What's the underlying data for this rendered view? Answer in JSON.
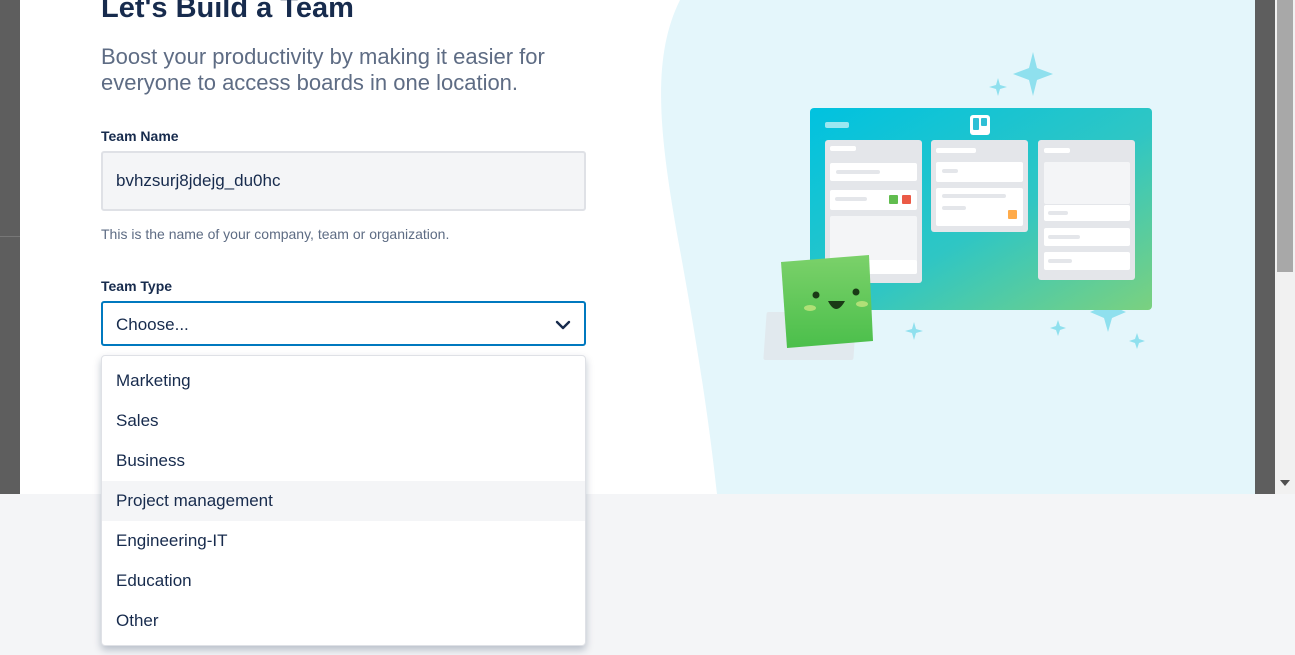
{
  "modal": {
    "title": "Let's Build a Team",
    "subtitle": "Boost your productivity by making it easier for everyone to access boards in one location."
  },
  "form": {
    "team_name_label": "Team Name",
    "team_name_value": "bvhzsurj8jdejg_du0hc",
    "team_name_helper": "This is the name of your company, team or organization.",
    "team_type_label": "Team Type",
    "team_type_selected": "Choose..."
  },
  "dropdown": {
    "options": [
      "Marketing",
      "Sales",
      "Business",
      "Project management",
      "Engineering-IT",
      "Education",
      "Other"
    ],
    "highlighted": "Project management"
  },
  "icons": {
    "select": "chevron-down-icon",
    "logo": "board-logo-icon",
    "mascot": "smiling-card-mascot-icon",
    "decor": "sparkle-icon"
  },
  "colors": {
    "accent": "#0079bf",
    "title": "#172b4d",
    "muted": "#5e6c84",
    "illustration_bg": "#e4f6fb"
  }
}
